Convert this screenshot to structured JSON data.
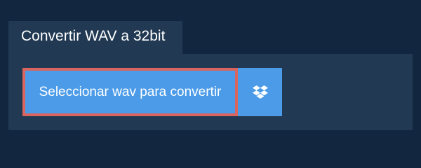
{
  "tab": {
    "title": "Convertir WAV a 32bit"
  },
  "panel": {
    "select_button_label": "Seleccionar wav para convertir",
    "dropbox_icon": "dropbox-icon"
  },
  "colors": {
    "page_background": "#13263f",
    "panel_background": "#213952",
    "button_background": "#4b9be8",
    "button_focus_border": "#d9655e",
    "text": "#ffffff"
  }
}
